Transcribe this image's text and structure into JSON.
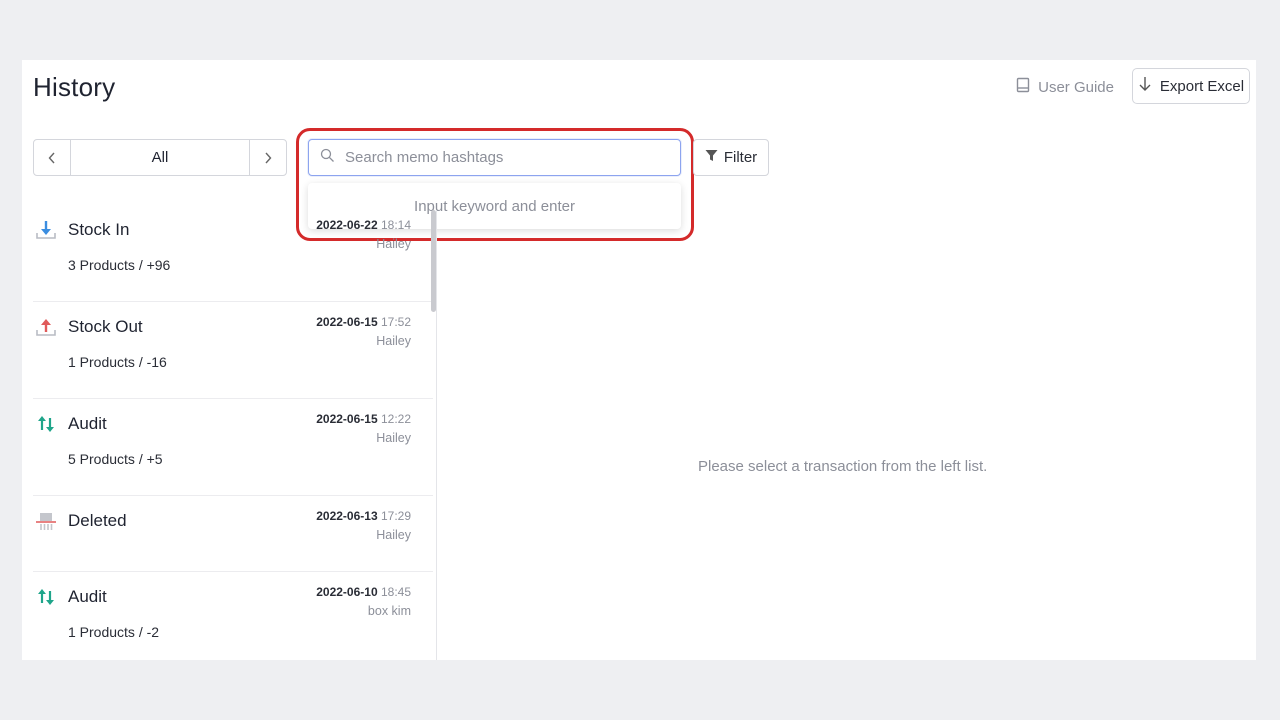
{
  "header": {
    "title": "History",
    "user_guide_label": "User Guide",
    "export_label": "Export Excel"
  },
  "toolbar": {
    "period_label": "All",
    "search_placeholder": "Search memo hashtags",
    "search_hint": "Input keyword and enter",
    "filter_label": "Filter"
  },
  "transactions": [
    {
      "type": "Stock In",
      "icon": "stock-in-icon",
      "summary": "3 Products / +96",
      "date": "2022-06-22",
      "time": "18:14",
      "user": "Hailey"
    },
    {
      "type": "Stock Out",
      "icon": "stock-out-icon",
      "summary": "1 Products / -16",
      "date": "2022-06-15",
      "time": "17:52",
      "user": "Hailey"
    },
    {
      "type": "Audit",
      "icon": "audit-icon",
      "summary": "5 Products / +5",
      "date": "2022-06-15",
      "time": "12:22",
      "user": "Hailey"
    },
    {
      "type": "Deleted",
      "icon": "deleted-icon",
      "summary": "",
      "date": "2022-06-13",
      "time": "17:29",
      "user": "Hailey"
    },
    {
      "type": "Audit",
      "icon": "audit-icon",
      "summary": "1 Products / -2",
      "date": "2022-06-10",
      "time": "18:45",
      "user": "box kim"
    }
  ],
  "detail": {
    "empty_message": "Please select a transaction from the left list."
  },
  "colors": {
    "stock_in": "#3b8de0",
    "stock_out": "#e05a5a",
    "audit": "#1fa58a",
    "highlight": "#d42a2a",
    "search_focus": "#8da4ef"
  }
}
